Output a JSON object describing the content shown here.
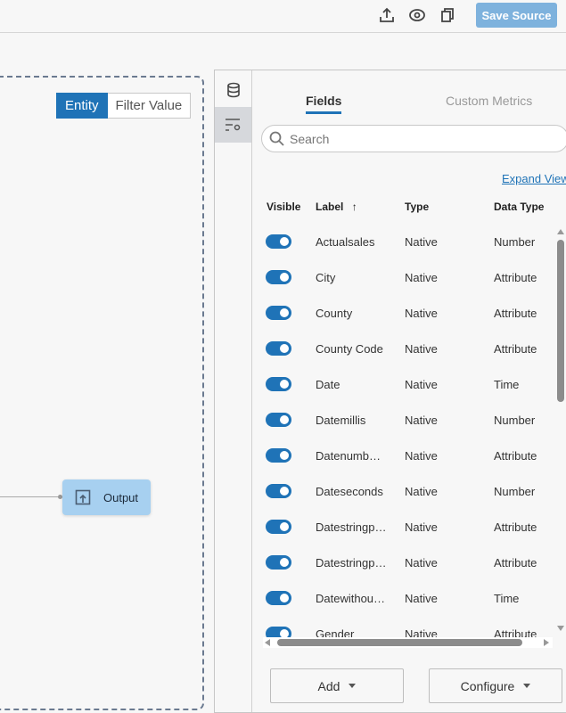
{
  "toolbar": {
    "save_label": "Save Source",
    "icons": [
      "upload-icon",
      "eye-icon",
      "copy-icon"
    ]
  },
  "canvas": {
    "toggle": {
      "options": [
        "Entity",
        "Filter Value"
      ],
      "selected": "Entity"
    },
    "node": {
      "label": "Output",
      "icon": "output-icon"
    }
  },
  "panel": {
    "side_icons": [
      "database-icon",
      "filter-settings-icon"
    ],
    "tabs": [
      {
        "label": "Fields",
        "active": true
      },
      {
        "label": "Custom Metrics",
        "active": false
      }
    ],
    "search": {
      "placeholder": "Search",
      "value": ""
    },
    "expand_view": "Expand View",
    "columns": [
      "Visible",
      "Label",
      "Type",
      "Data Type"
    ],
    "sort": "Label ascending",
    "rows": [
      {
        "visible": true,
        "label": "Actualsales",
        "type": "Native",
        "data_type": "Number"
      },
      {
        "visible": true,
        "label": "City",
        "type": "Native",
        "data_type": "Attribute"
      },
      {
        "visible": true,
        "label": "County",
        "type": "Native",
        "data_type": "Attribute"
      },
      {
        "visible": true,
        "label": "County Code",
        "type": "Native",
        "data_type": "Attribute"
      },
      {
        "visible": true,
        "label": "Date",
        "type": "Native",
        "data_type": "Time"
      },
      {
        "visible": true,
        "label": "Datemillis",
        "type": "Native",
        "data_type": "Number"
      },
      {
        "visible": true,
        "label": "Datenumb…",
        "type": "Native",
        "data_type": "Attribute"
      },
      {
        "visible": true,
        "label": "Dateseconds",
        "type": "Native",
        "data_type": "Number"
      },
      {
        "visible": true,
        "label": "Datestringp…",
        "type": "Native",
        "data_type": "Attribute"
      },
      {
        "visible": true,
        "label": "Datestringp…",
        "type": "Native",
        "data_type": "Attribute"
      },
      {
        "visible": true,
        "label": "Datewithou…",
        "type": "Native",
        "data_type": "Time"
      },
      {
        "visible": true,
        "label": "Gender",
        "type": "Native",
        "data_type": "Attribute"
      }
    ],
    "buttons": {
      "add": "Add",
      "configure": "Configure"
    },
    "accent": "#1f73b7"
  }
}
